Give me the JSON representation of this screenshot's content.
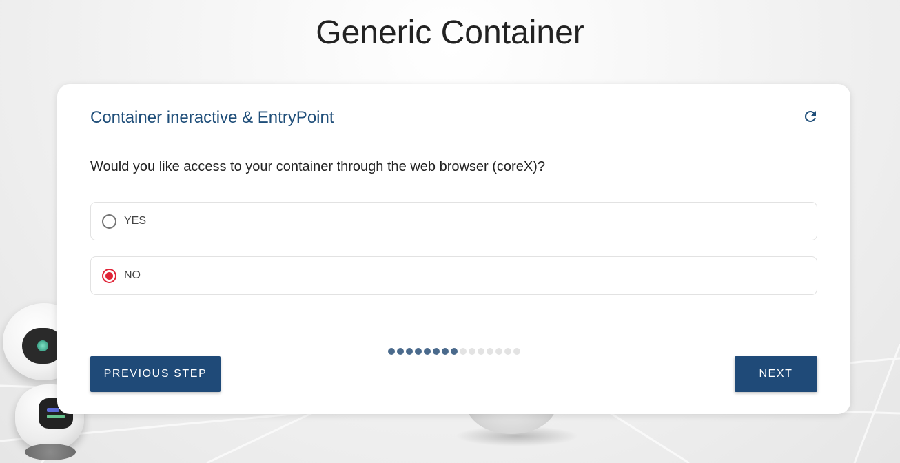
{
  "page": {
    "title": "Generic Container"
  },
  "card": {
    "title": "Container ineractive & EntryPoint",
    "refresh_icon": "refresh-icon",
    "question": "Would you like access to your container through the web browser (coreX)?",
    "options": [
      {
        "label": "YES",
        "selected": false
      },
      {
        "label": "NO",
        "selected": true
      }
    ],
    "progress": {
      "completed_steps": 8,
      "total_steps": 15
    },
    "buttons": {
      "previous": "PREVIOUS STEP",
      "next": "NEXT"
    }
  },
  "colors": {
    "primary": "#1f4a78",
    "title_blue": "#1f4e79",
    "radio_selected": "#e02437",
    "dot_done": "#4a6a8c",
    "dot_todo": "#e3e3e3"
  }
}
